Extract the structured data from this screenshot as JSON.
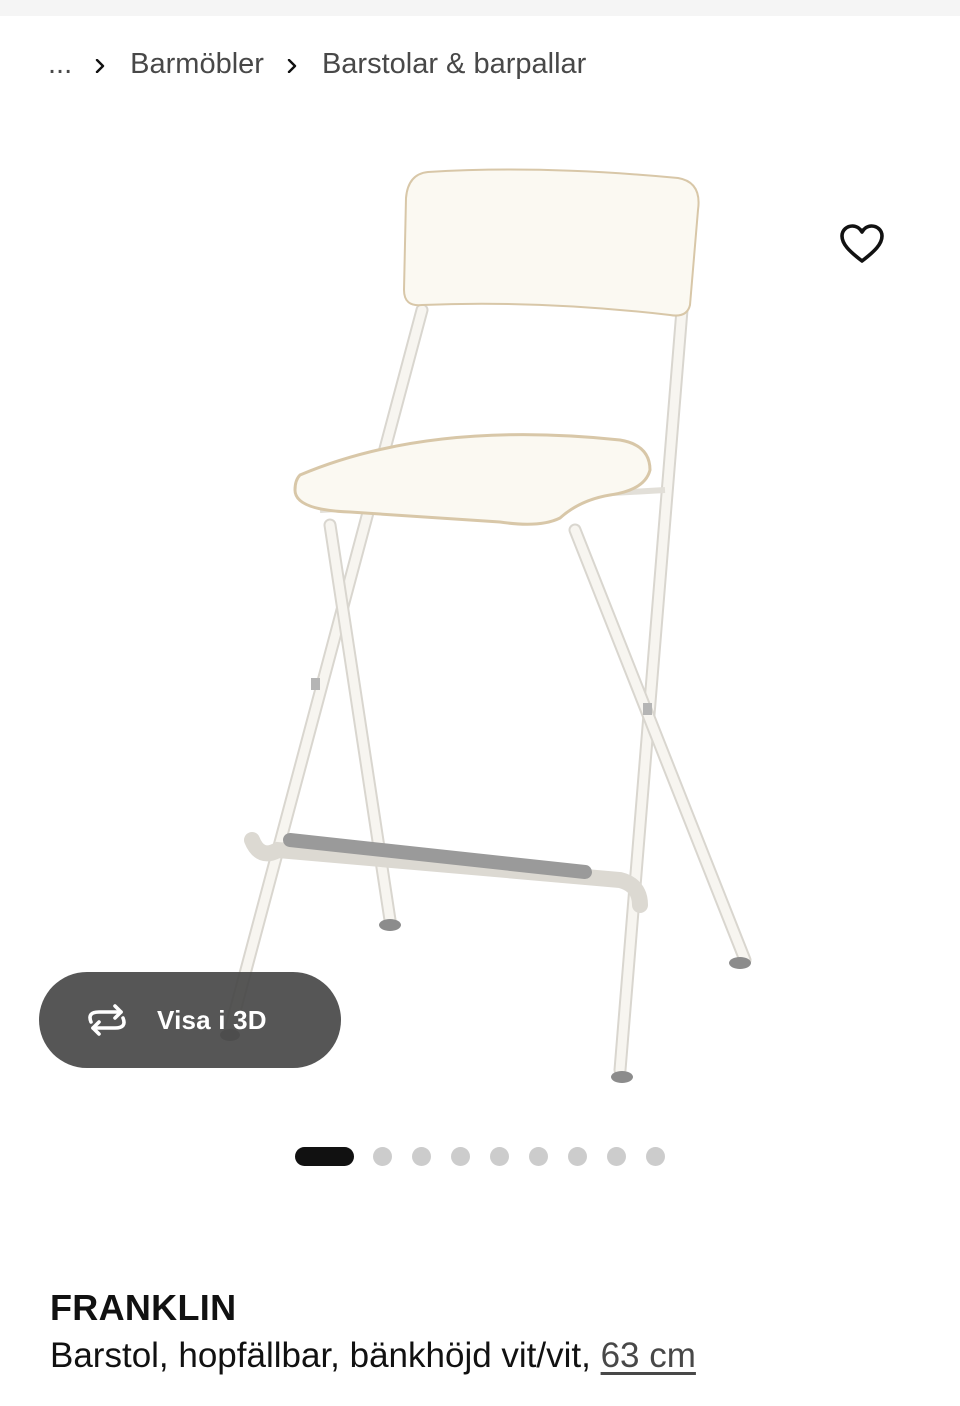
{
  "breadcrumb": {
    "ellipsis": "...",
    "items": [
      {
        "label": "Barmöbler"
      },
      {
        "label": "Barstolar & barpallar"
      }
    ]
  },
  "product_image": {
    "subject": "white folding bar stool",
    "colors": {
      "frame": "#f4f2ec",
      "seat": "#fbf9f2",
      "seat_edge": "#d8c7a8",
      "footrest": "#9a9a9a",
      "feet": "#8c8c8c"
    }
  },
  "favorite": {
    "icon": "heart-outline-icon"
  },
  "view3d": {
    "label": "Visa i 3D",
    "icon": "rotate-arrows-icon"
  },
  "carousel": {
    "total": 9,
    "active_index": 0
  },
  "product": {
    "name": "FRANKLIN",
    "description": "Barstol, hopfällbar, bänkhöjd vit/vit,",
    "size_link": "63 cm"
  },
  "colors": {
    "text": "#111111",
    "muted": "#484848",
    "dot_inactive": "#cccccc",
    "dot_active": "#111111",
    "overlay_button": "#484848"
  }
}
